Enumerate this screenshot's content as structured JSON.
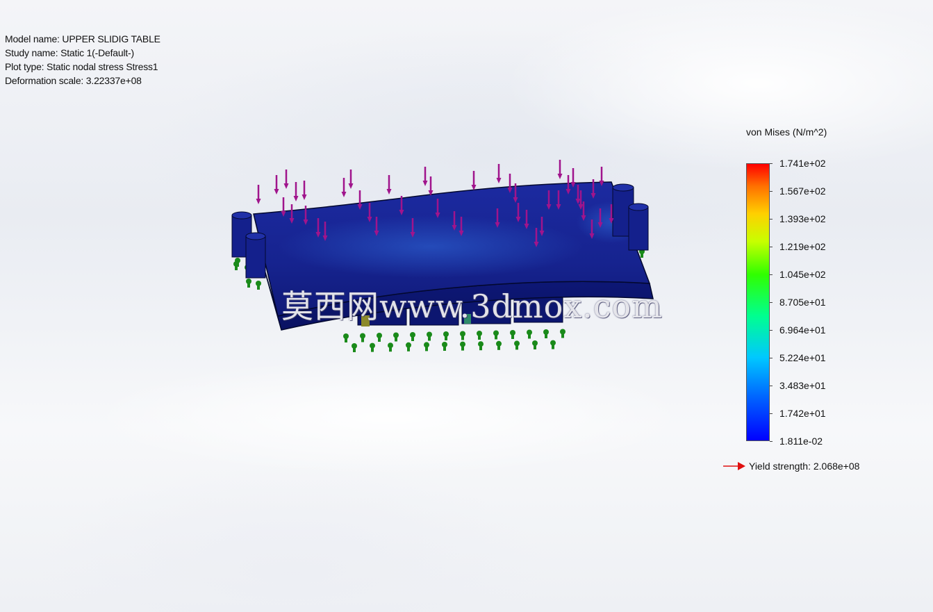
{
  "study_info": {
    "model_name": "Model name: UPPER SLIDIG TABLE",
    "study_name": "Study name: Static 1(-Default-)",
    "plot_type": "Plot type: Static nodal stress Stress1",
    "deformation_scale": "Deformation scale: 3.22337e+08"
  },
  "legend": {
    "title": "von Mises (N/m^2)",
    "ticks": [
      "1.741e+02",
      "1.567e+02",
      "1.393e+02",
      "1.219e+02",
      "1.045e+02",
      "8.705e+01",
      "6.964e+01",
      "5.224e+01",
      "3.483e+01",
      "1.742e+01",
      "1.811e-02"
    ],
    "yield_strength": "Yield strength: 2.068e+08",
    "colors": {
      "max": "#ff0000",
      "mid": "#30ff00",
      "min": "#0000ff",
      "yield_arrow": "#e01010"
    }
  },
  "model_colors": {
    "body": "#14208c",
    "load_arrow": "#a0148c",
    "fixture": "#1a8a1a"
  },
  "watermark": "莫西网www.3dmox.com"
}
